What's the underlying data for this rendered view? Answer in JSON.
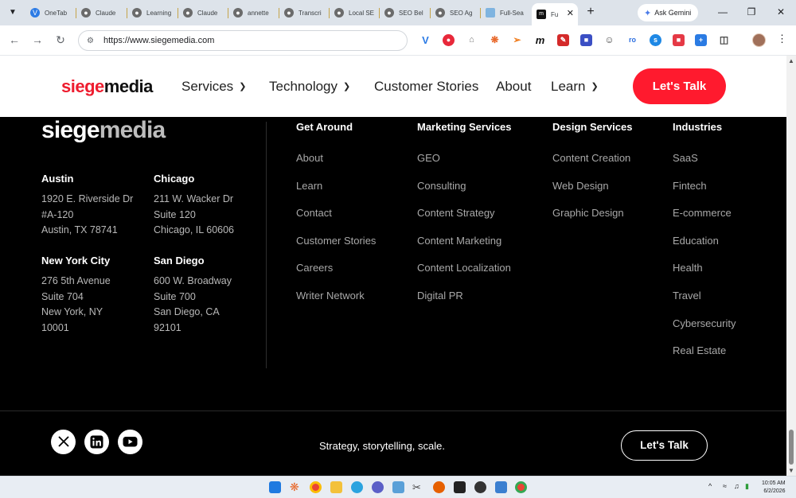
{
  "browser": {
    "tabs": [
      {
        "title": "OneTab",
        "color": "#2c7be5"
      },
      {
        "title": "Claude",
        "color": "#6b6b6b"
      },
      {
        "title": "Learning",
        "color": "#6b6b6b"
      },
      {
        "title": "Claude",
        "color": "#6b6b6b"
      },
      {
        "title": "annette",
        "color": "#6b6b6b"
      },
      {
        "title": "Transcri",
        "color": "#6b6b6b"
      },
      {
        "title": "Local SE",
        "color": "#6b6b6b"
      },
      {
        "title": "SEO Bel",
        "color": "#6b6b6b"
      },
      {
        "title": "SEO Ag",
        "color": "#6b6b6b"
      },
      {
        "title": "Full-Sea",
        "color": "#7fb4e0"
      },
      {
        "title": "Fu",
        "color": "#111111"
      }
    ],
    "ask_gemini": "Ask Gemini",
    "url": "https://www.siegemedia.com"
  },
  "site": {
    "logo_part1": "siege",
    "logo_part2": "media",
    "nav": {
      "services": "Services",
      "technology": "Technology",
      "customer_stories": "Customer Stories",
      "about": "About",
      "learn": "Learn"
    },
    "cta": "Let's Talk"
  },
  "footer": {
    "offices": [
      {
        "city": "Austin",
        "lines": [
          "1920 E. Riverside Dr",
          "#A-120",
          "Austin, TX 78741"
        ]
      },
      {
        "city": "Chicago",
        "lines": [
          "211 W. Wacker Dr",
          "Suite 120",
          "Chicago, IL 60606"
        ]
      },
      {
        "city": "New York City",
        "lines": [
          "276 5th Avenue",
          "Suite 704",
          "New York, NY",
          "10001"
        ]
      },
      {
        "city": "San Diego",
        "lines": [
          "600 W. Broadway",
          "Suite 700",
          "San Diego, CA",
          "92101"
        ]
      }
    ],
    "columns": [
      {
        "heading": "Get Around",
        "links": [
          "About",
          "Learn",
          "Contact",
          "Customer Stories",
          "Careers",
          "Writer Network"
        ]
      },
      {
        "heading": "Marketing Services",
        "links": [
          "GEO",
          "Consulting",
          "Content Strategy",
          "Content Marketing",
          "Content Localization",
          "Digital PR"
        ]
      },
      {
        "heading": "Design Services",
        "links": [
          "Content Creation",
          "Web Design",
          "Graphic Design"
        ]
      },
      {
        "heading": "Industries",
        "links": [
          "SaaS",
          "Fintech",
          "E-commerce",
          "Education",
          "Health",
          "Travel",
          "Cybersecurity",
          "Real Estate"
        ]
      }
    ],
    "tagline": "Strategy, storytelling, scale.",
    "cta": "Let's Talk"
  },
  "taskbar": {
    "time": "10:05 AM",
    "date": "6/2/2026"
  }
}
